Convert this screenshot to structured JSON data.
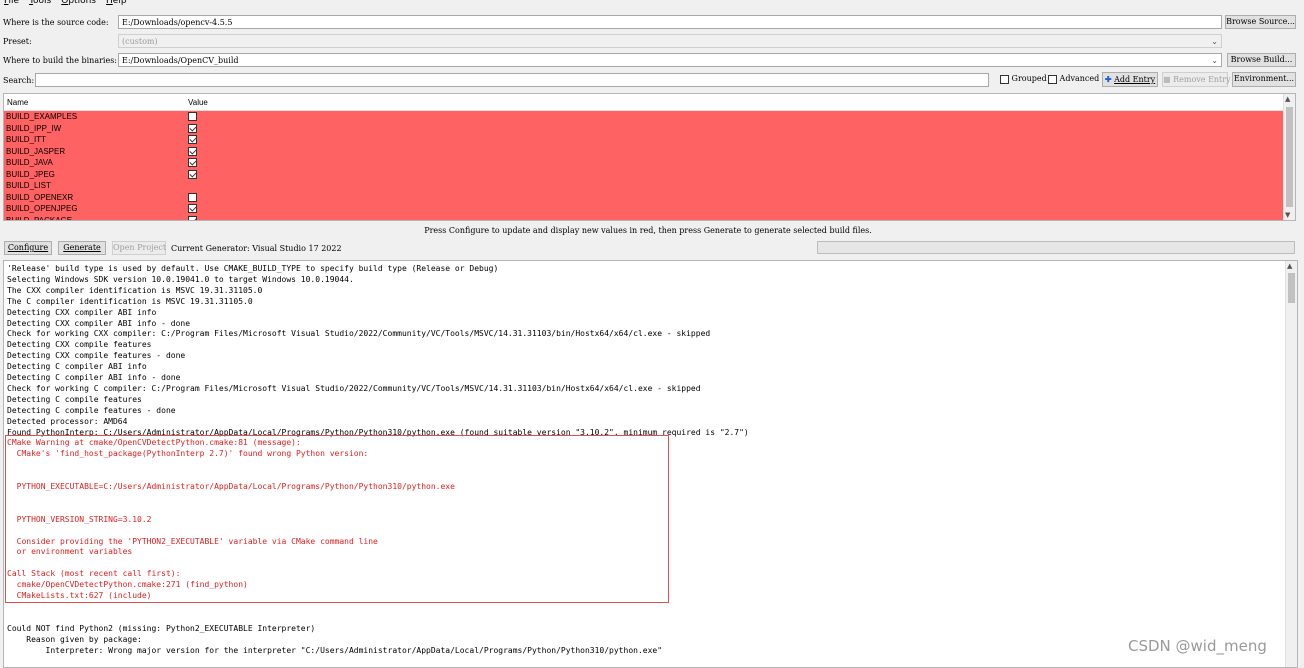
{
  "menu": [
    {
      "accel": "F",
      "rest": "ile"
    },
    {
      "accel": "T",
      "rest": "ools"
    },
    {
      "accel": "O",
      "rest": "ptions"
    },
    {
      "accel": "H",
      "rest": "elp"
    }
  ],
  "source": {
    "label": "Where is the source code:",
    "value": "E:/Downloads/opencv-4.5.5",
    "button": "Browse Source..."
  },
  "preset": {
    "label": "Preset:",
    "value": "(custom)"
  },
  "build": {
    "label": "Where to build the binaries:",
    "value": "E:/Downloads/OpenCV_build",
    "button": "Browse Build..."
  },
  "search": {
    "label": "Search:",
    "value": ""
  },
  "options": {
    "grouped": "Grouped",
    "advanced": "Advanced",
    "add_entry": "Add Entry",
    "remove_entry": "Remove Entry",
    "environment": "Environment..."
  },
  "table": {
    "col_name": "Name",
    "col_value": "Value",
    "rows": [
      {
        "name": "BUILD_EXAMPLES",
        "checked": false,
        "has_check": true
      },
      {
        "name": "BUILD_IPP_IW",
        "checked": true,
        "has_check": true
      },
      {
        "name": "BUILD_ITT",
        "checked": true,
        "has_check": true
      },
      {
        "name": "BUILD_JASPER",
        "checked": true,
        "has_check": true
      },
      {
        "name": "BUILD_JAVA",
        "checked": true,
        "has_check": true
      },
      {
        "name": "BUILD_JPEG",
        "checked": true,
        "has_check": true
      },
      {
        "name": "BUILD_LIST",
        "checked": false,
        "has_check": false
      },
      {
        "name": "BUILD_OPENEXR",
        "checked": false,
        "has_check": true
      },
      {
        "name": "BUILD_OPENJPEG",
        "checked": true,
        "has_check": true
      },
      {
        "name": "BUILD_PACKAGE",
        "checked": true,
        "has_check": true
      }
    ]
  },
  "hint": "Press Configure to update and display new values in red, then press Generate to generate selected build files.",
  "actions": {
    "configure": "Configure",
    "generate": "Generate",
    "open_project": "Open Project",
    "generator": "Current Generator: Visual Studio 17 2022"
  },
  "output": [
    {
      "t": "'Release' build type is used by default. Use CMAKE_BUILD_TYPE to specify build type (Release or Debug)",
      "red": false
    },
    {
      "t": "Selecting Windows SDK version 10.0.19041.0 to target Windows 10.0.19044.",
      "red": false
    },
    {
      "t": "The CXX compiler identification is MSVC 19.31.31105.0",
      "red": false
    },
    {
      "t": "The C compiler identification is MSVC 19.31.31105.0",
      "red": false
    },
    {
      "t": "Detecting CXX compiler ABI info",
      "red": false
    },
    {
      "t": "Detecting CXX compiler ABI info - done",
      "red": false
    },
    {
      "t": "Check for working CXX compiler: C:/Program Files/Microsoft Visual Studio/2022/Community/VC/Tools/MSVC/14.31.31103/bin/Hostx64/x64/cl.exe - skipped",
      "red": false
    },
    {
      "t": "Detecting CXX compile features",
      "red": false
    },
    {
      "t": "Detecting CXX compile features - done",
      "red": false
    },
    {
      "t": "Detecting C compiler ABI info",
      "red": false
    },
    {
      "t": "Detecting C compiler ABI info - done",
      "red": false
    },
    {
      "t": "Check for working C compiler: C:/Program Files/Microsoft Visual Studio/2022/Community/VC/Tools/MSVC/14.31.31103/bin/Hostx64/x64/cl.exe - skipped",
      "red": false
    },
    {
      "t": "Detecting C compile features",
      "red": false
    },
    {
      "t": "Detecting C compile features - done",
      "red": false
    },
    {
      "t": "Detected processor: AMD64",
      "red": false
    },
    {
      "t": "Found PythonInterp: C:/Users/Administrator/AppData/Local/Programs/Python/Python310/python.exe (found suitable version \"3.10.2\", minimum required is \"2.7\")",
      "red": false
    },
    {
      "t": "CMake Warning at cmake/OpenCVDetectPython.cmake:81 (message):",
      "red": true
    },
    {
      "t": "  CMake's 'find_host_package(PythonInterp 2.7)' found wrong Python version:",
      "red": true
    },
    {
      "t": "",
      "red": true
    },
    {
      "t": "",
      "red": true
    },
    {
      "t": "  PYTHON_EXECUTABLE=C:/Users/Administrator/AppData/Local/Programs/Python/Python310/python.exe",
      "red": true
    },
    {
      "t": "",
      "red": true
    },
    {
      "t": "",
      "red": true
    },
    {
      "t": "  PYTHON_VERSION_STRING=3.10.2",
      "red": true
    },
    {
      "t": "",
      "red": true
    },
    {
      "t": "  Consider providing the 'PYTHON2_EXECUTABLE' variable via CMake command line",
      "red": true
    },
    {
      "t": "  or environment variables",
      "red": true
    },
    {
      "t": "",
      "red": true
    },
    {
      "t": "Call Stack (most recent call first):",
      "red": true
    },
    {
      "t": "  cmake/OpenCVDetectPython.cmake:271 (find_python)",
      "red": true
    },
    {
      "t": "  CMakeLists.txt:627 (include)",
      "red": true
    },
    {
      "t": "",
      "red": false
    },
    {
      "t": "",
      "red": false
    },
    {
      "t": "Could NOT find Python2 (missing: Python2_EXECUTABLE Interpreter)",
      "red": false
    },
    {
      "t": "    Reason given by package:",
      "red": false
    },
    {
      "t": "        Interpreter: Wrong major version for the interpreter \"C:/Users/Administrator/AppData/Local/Programs/Python/Python310/python.exe\"",
      "red": false
    }
  ],
  "watermark": "CSDN @wid_meng",
  "colors": {
    "changed_row": "#ff6262",
    "warning_text": "#e02020"
  }
}
